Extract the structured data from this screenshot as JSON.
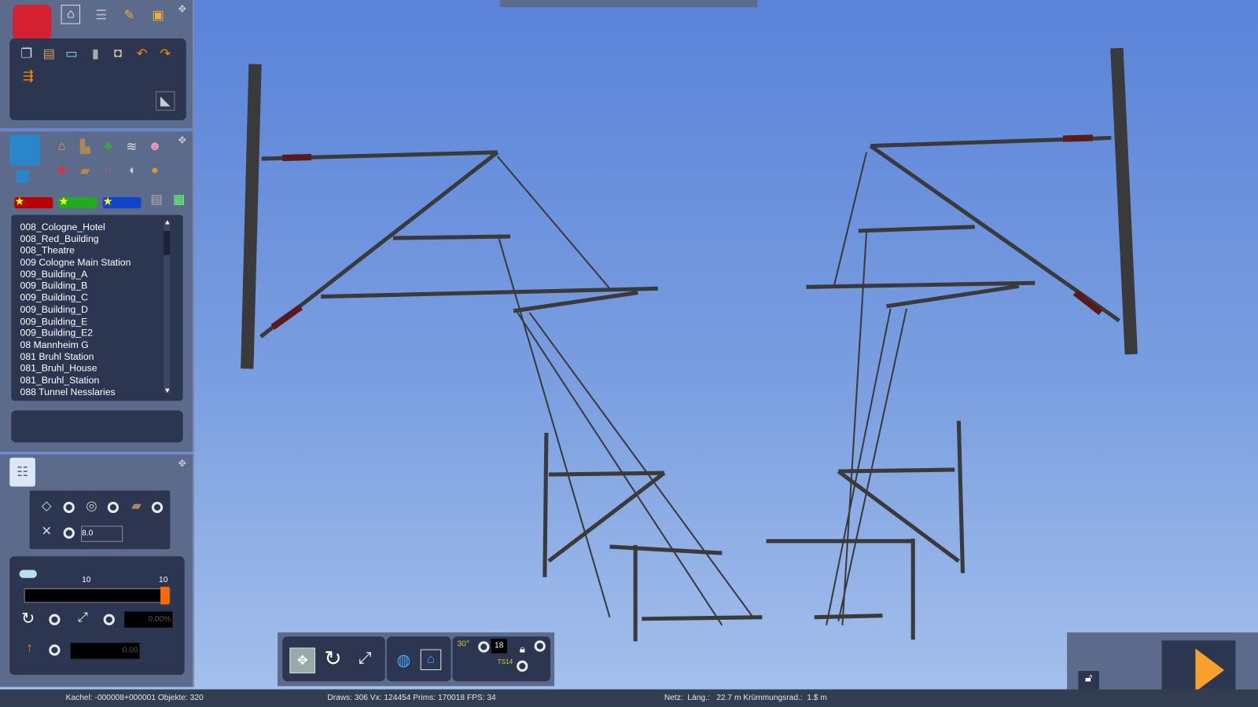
{
  "top_panel": {
    "tabs": [
      "home-icon",
      "track-icon",
      "paint-brush-icon",
      "train-icon"
    ],
    "tools": [
      "copy-icon",
      "paste-icon",
      "monitor-icon",
      "trash-icon",
      "measure-icon",
      "undo-icon",
      "redo-icon",
      "eraser-icon"
    ]
  },
  "object_panel": {
    "categories": [
      "house-icon",
      "factory-icon",
      "tree-icon",
      "rock-icon",
      "person-icon",
      "signal-icon",
      "bench-icon",
      "bridge-icon",
      "speaker-icon",
      "sack-icon"
    ],
    "list": [
      "008_Cologne_Hotel",
      "008_Red_Building",
      "008_Theatre",
      "009 Cologne Main Station",
      "009_Building_A",
      "009_Building_B",
      "009_Building_C",
      "009_Building_D",
      "009_Building_E",
      "009_Building_E2",
      "08 Mannheim G",
      "081 Bruhl Station",
      "081_Bruhl_House",
      "081_Bruhl_Station",
      "088 Tunnel Nesslaries"
    ]
  },
  "properties_panel": {
    "height_value": "8.0",
    "slider_min_label": "10",
    "slider_max_label": "10",
    "slider_value": 1.0,
    "scale_value": "0.00%",
    "elevation_value": "0.00",
    "accent": "#ff6a00"
  },
  "toolbar": {
    "grid_value": "18",
    "angle_label": "30°",
    "ts_label": "TS14"
  },
  "status": {
    "tile": "Kachel: -000008+000001  Objekte: 320",
    "stats": "Draws: 306 Vx: 124454 Prims: 170018 FPS: 34",
    "net": "Netz:  Läng.:   22.7 m Krümmungsrad.:  1.$ m"
  }
}
